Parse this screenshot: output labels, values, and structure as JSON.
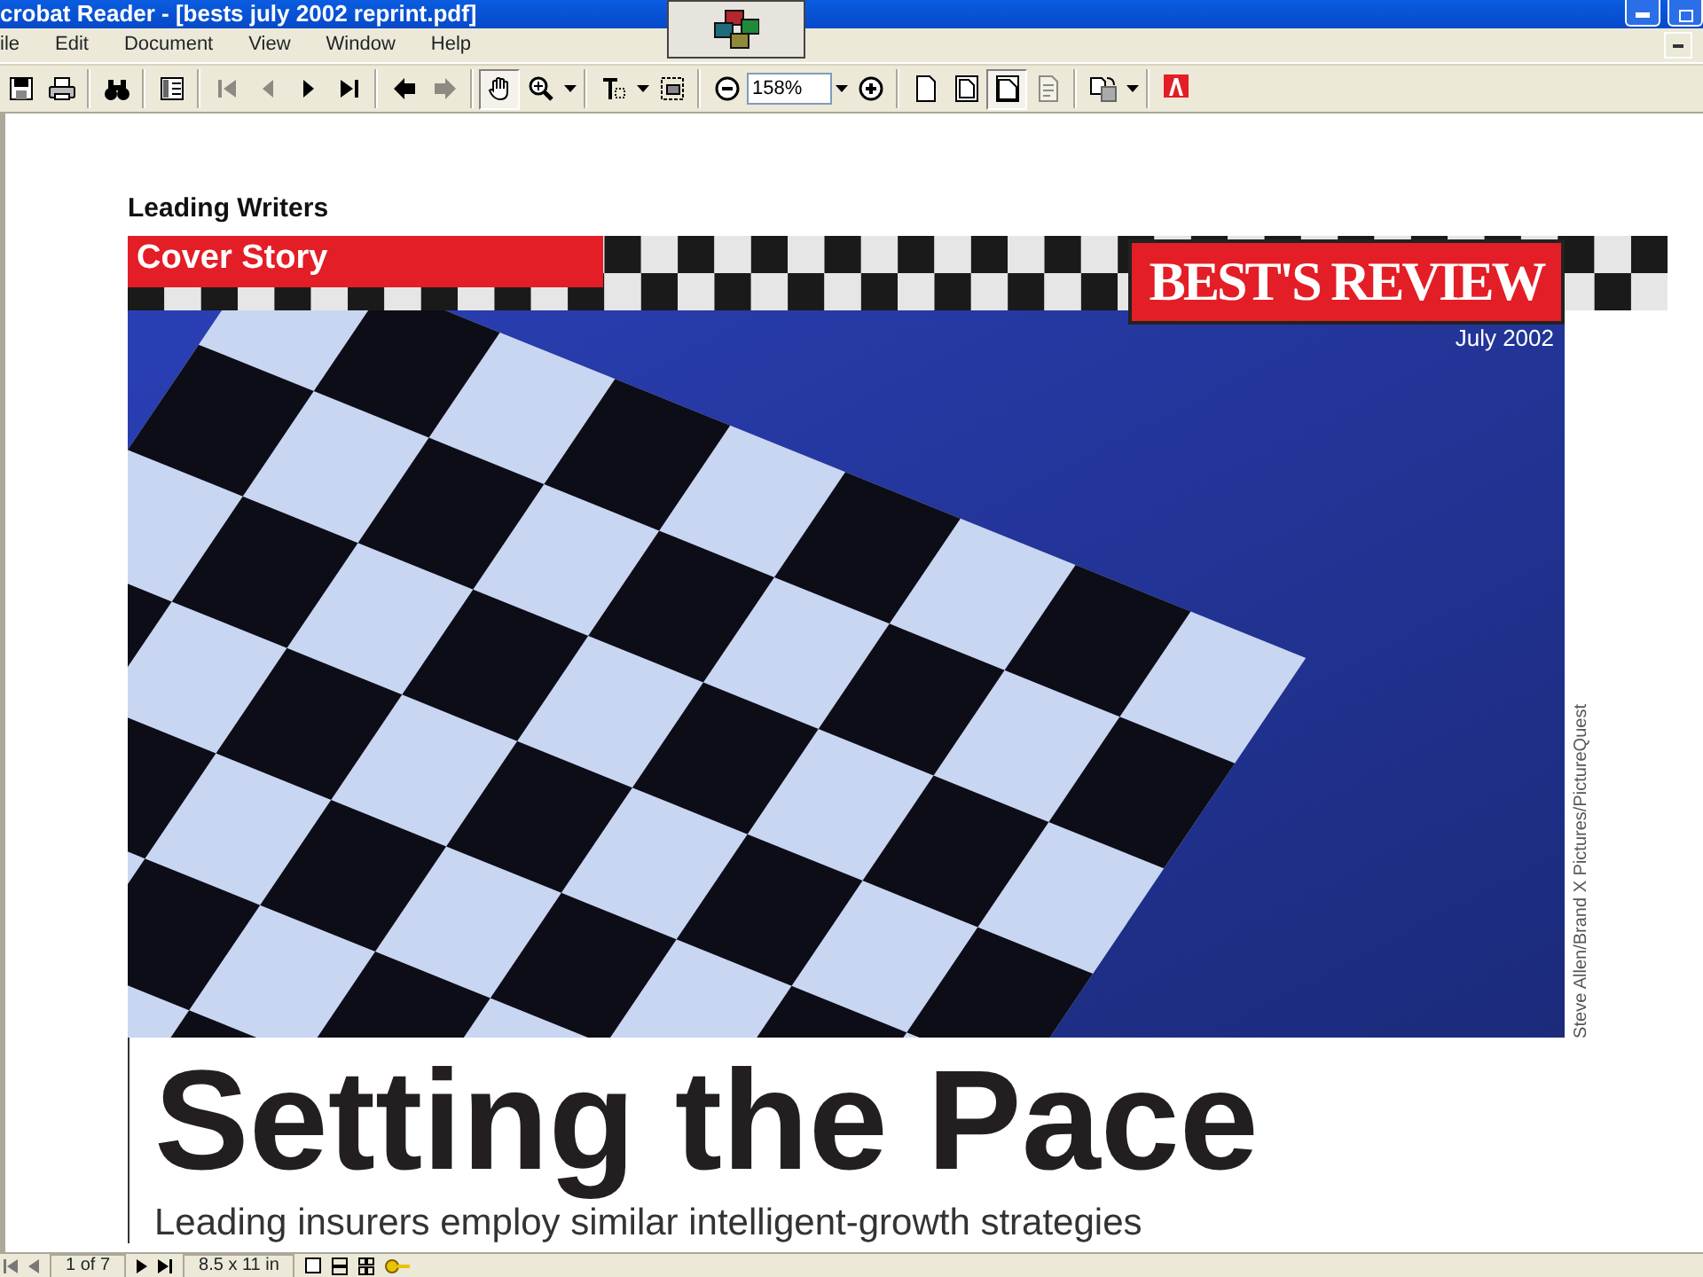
{
  "window": {
    "title": "crobat Reader - [bests july 2002 reprint.pdf]"
  },
  "menu": [
    {
      "label": "ile"
    },
    {
      "label": "Edit"
    },
    {
      "label": "Document"
    },
    {
      "label": "View"
    },
    {
      "label": "Window"
    },
    {
      "label": "Help"
    }
  ],
  "toolbar": {
    "items": [
      {
        "kind": "save",
        "disabled": false,
        "selected": false
      },
      {
        "kind": "print",
        "disabled": false,
        "selected": false
      },
      {
        "kind": "separator"
      },
      {
        "kind": "find",
        "disabled": false,
        "selected": false
      },
      {
        "kind": "separator"
      },
      {
        "kind": "panes",
        "disabled": false,
        "selected": false
      },
      {
        "kind": "separator"
      },
      {
        "kind": "first",
        "disabled": true,
        "selected": false
      },
      {
        "kind": "prev",
        "disabled": true,
        "selected": false
      },
      {
        "kind": "next",
        "disabled": false,
        "selected": false
      },
      {
        "kind": "last",
        "disabled": false,
        "selected": false
      },
      {
        "kind": "separator"
      },
      {
        "kind": "back",
        "disabled": false,
        "selected": false
      },
      {
        "kind": "forward",
        "disabled": true,
        "selected": false
      },
      {
        "kind": "separator"
      },
      {
        "kind": "hand",
        "disabled": false,
        "selected": true
      },
      {
        "kind": "zoom",
        "disabled": false,
        "selected": false
      },
      {
        "kind": "separator"
      },
      {
        "kind": "text",
        "disabled": false,
        "selected": false
      },
      {
        "kind": "snapshot",
        "disabled": false,
        "selected": false
      },
      {
        "kind": "separator"
      },
      {
        "kind": "zoomout",
        "disabled": false,
        "selected": false
      },
      {
        "kind": "zoomfield",
        "value": "158%"
      },
      {
        "kind": "zoomin",
        "disabled": false,
        "selected": false
      },
      {
        "kind": "separator"
      },
      {
        "kind": "actual",
        "disabled": false,
        "selected": false
      },
      {
        "kind": "fitpage",
        "disabled": false,
        "selected": false
      },
      {
        "kind": "fitwidth",
        "disabled": false,
        "selected": true
      },
      {
        "kind": "reflow",
        "disabled": true,
        "selected": false
      },
      {
        "kind": "separator"
      },
      {
        "kind": "rotate",
        "disabled": false,
        "selected": false
      },
      {
        "kind": "separator"
      },
      {
        "kind": "adobe",
        "disabled": false,
        "selected": false
      }
    ]
  },
  "document": {
    "section": "Leading Writers",
    "banner": "Cover Story",
    "logo": "BEST'S REVIEW",
    "date": "July 2002",
    "photo_credit": "Steve Allen/Brand X Pictures/PictureQuest",
    "headline": "Setting the Pace",
    "subhead": "Leading insurers employ similar intelligent-growth strategies"
  },
  "status_bar": {
    "page": "1 of 7",
    "page_size": "8.5 x 11 in"
  }
}
